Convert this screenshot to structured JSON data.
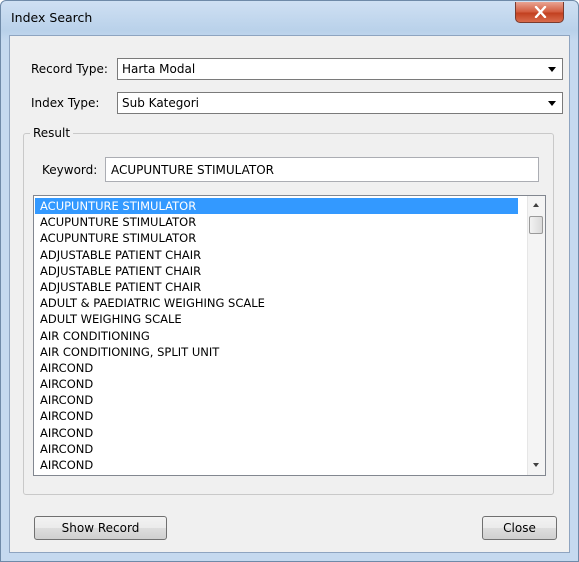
{
  "window": {
    "title": "Index Search"
  },
  "record_type": {
    "label": "Record Type:",
    "value": "Harta Modal"
  },
  "index_type": {
    "label": "Index Type:",
    "value": "Sub Kategori"
  },
  "result": {
    "group_label": "Result"
  },
  "keyword": {
    "label": "Keyword:",
    "value": "ACUPUNTURE STIMULATOR"
  },
  "list": {
    "selected_index": 0,
    "items": [
      "ACUPUNTURE STIMULATOR",
      "ACUPUNTURE STIMULATOR",
      "ACUPUNTURE STIMULATOR",
      "ADJUSTABLE PATIENT CHAIR",
      "ADJUSTABLE PATIENT CHAIR",
      "ADJUSTABLE PATIENT CHAIR",
      "ADULT & PAEDIATRIC WEIGHING SCALE",
      "ADULT WEIGHING SCALE",
      "AIR CONDITIONING",
      "AIR CONDITIONING, SPLIT UNIT",
      "AIRCOND",
      "AIRCOND",
      "AIRCOND",
      "AIRCOND",
      "AIRCOND",
      "AIRCOND",
      "AIRCOND"
    ]
  },
  "buttons": {
    "show_record": "Show Record",
    "close": "Close"
  },
  "colors": {
    "selection": "#3399ff",
    "close_button": "#c2401f",
    "title_bar": "#b9d1ea"
  },
  "icons": {
    "close": "close-x-icon",
    "dropdown": "chevron-down-icon"
  }
}
